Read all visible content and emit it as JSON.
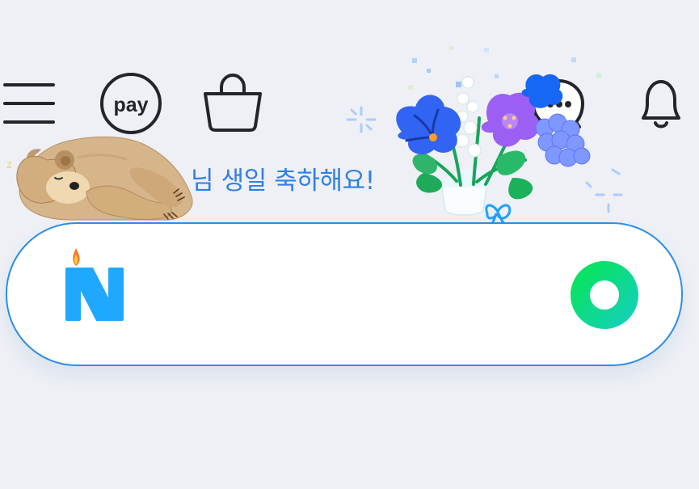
{
  "header": {
    "menu_icon": "hamburger-menu-icon",
    "pay_icon_text": "pay",
    "shopping_icon": "shopping-bag-icon",
    "talk_icon": "chat-bubble-icon",
    "notification_icon": "bell-icon"
  },
  "greeting": {
    "message": "님 생일 축하해요!"
  },
  "search": {
    "logo_letter": "N",
    "button_icon": "green-ring-search-icon"
  },
  "decoration": {
    "mascot": "sleeping-bear",
    "bouquet": "birthday-flower-bouquet",
    "sleep_glyph": "z"
  },
  "colors": {
    "background": "#eef0f5",
    "brand_blue": "#2f7fe7",
    "search_border": "#2d8ee6",
    "naver_n": "#20a8ff",
    "search_green": "#08d985",
    "icon_dark": "#23252b"
  }
}
